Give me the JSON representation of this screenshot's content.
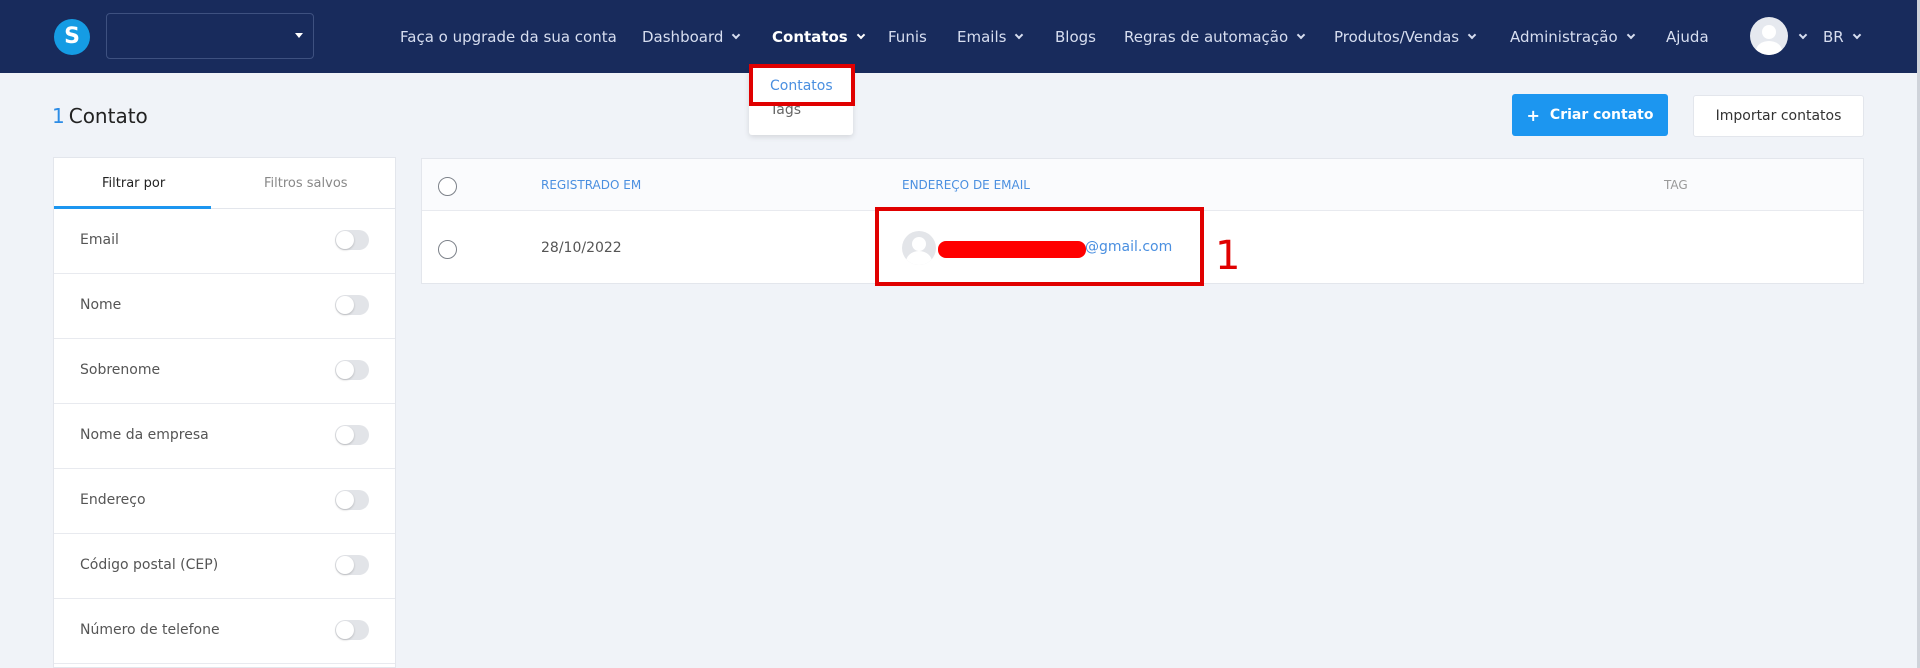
{
  "topbar": {
    "logo_letter": "S",
    "nav": [
      {
        "label": "Faça o upgrade da sua conta"
      },
      {
        "label": "Dashboard"
      },
      {
        "label": "Contatos"
      },
      {
        "label": "Funis"
      },
      {
        "label": "Emails"
      },
      {
        "label": "Blogs"
      },
      {
        "label": "Regras de automação"
      },
      {
        "label": "Produtos/Vendas"
      },
      {
        "label": "Administração"
      },
      {
        "label": "Ajuda"
      }
    ],
    "language": "BR"
  },
  "dropdown": {
    "items": [
      "Contatos",
      "Tags"
    ]
  },
  "page": {
    "count": "1",
    "title": "Contato",
    "create_label": "Criar contato",
    "import_label": "Importar contatos"
  },
  "sidebar": {
    "tabs": [
      "Filtrar por",
      "Filtros salvos"
    ],
    "filters": [
      {
        "label": "Email"
      },
      {
        "label": "Nome"
      },
      {
        "label": "Sobrenome"
      },
      {
        "label": "Nome da empresa"
      },
      {
        "label": "Endereço"
      },
      {
        "label": "Código postal (CEP)"
      },
      {
        "label": "Número de telefone"
      }
    ]
  },
  "table": {
    "columns": [
      "REGISTRADO EM",
      "ENDEREÇO DE EMAIL",
      "TAG"
    ],
    "rows": [
      {
        "date": "28/10/2022",
        "email_domain": "@gmail.com"
      }
    ]
  },
  "annotation": {
    "label": "1"
  },
  "colors": {
    "topbar": "#182b5c",
    "accent": "#1c96f0",
    "highlight": "#e00000"
  }
}
